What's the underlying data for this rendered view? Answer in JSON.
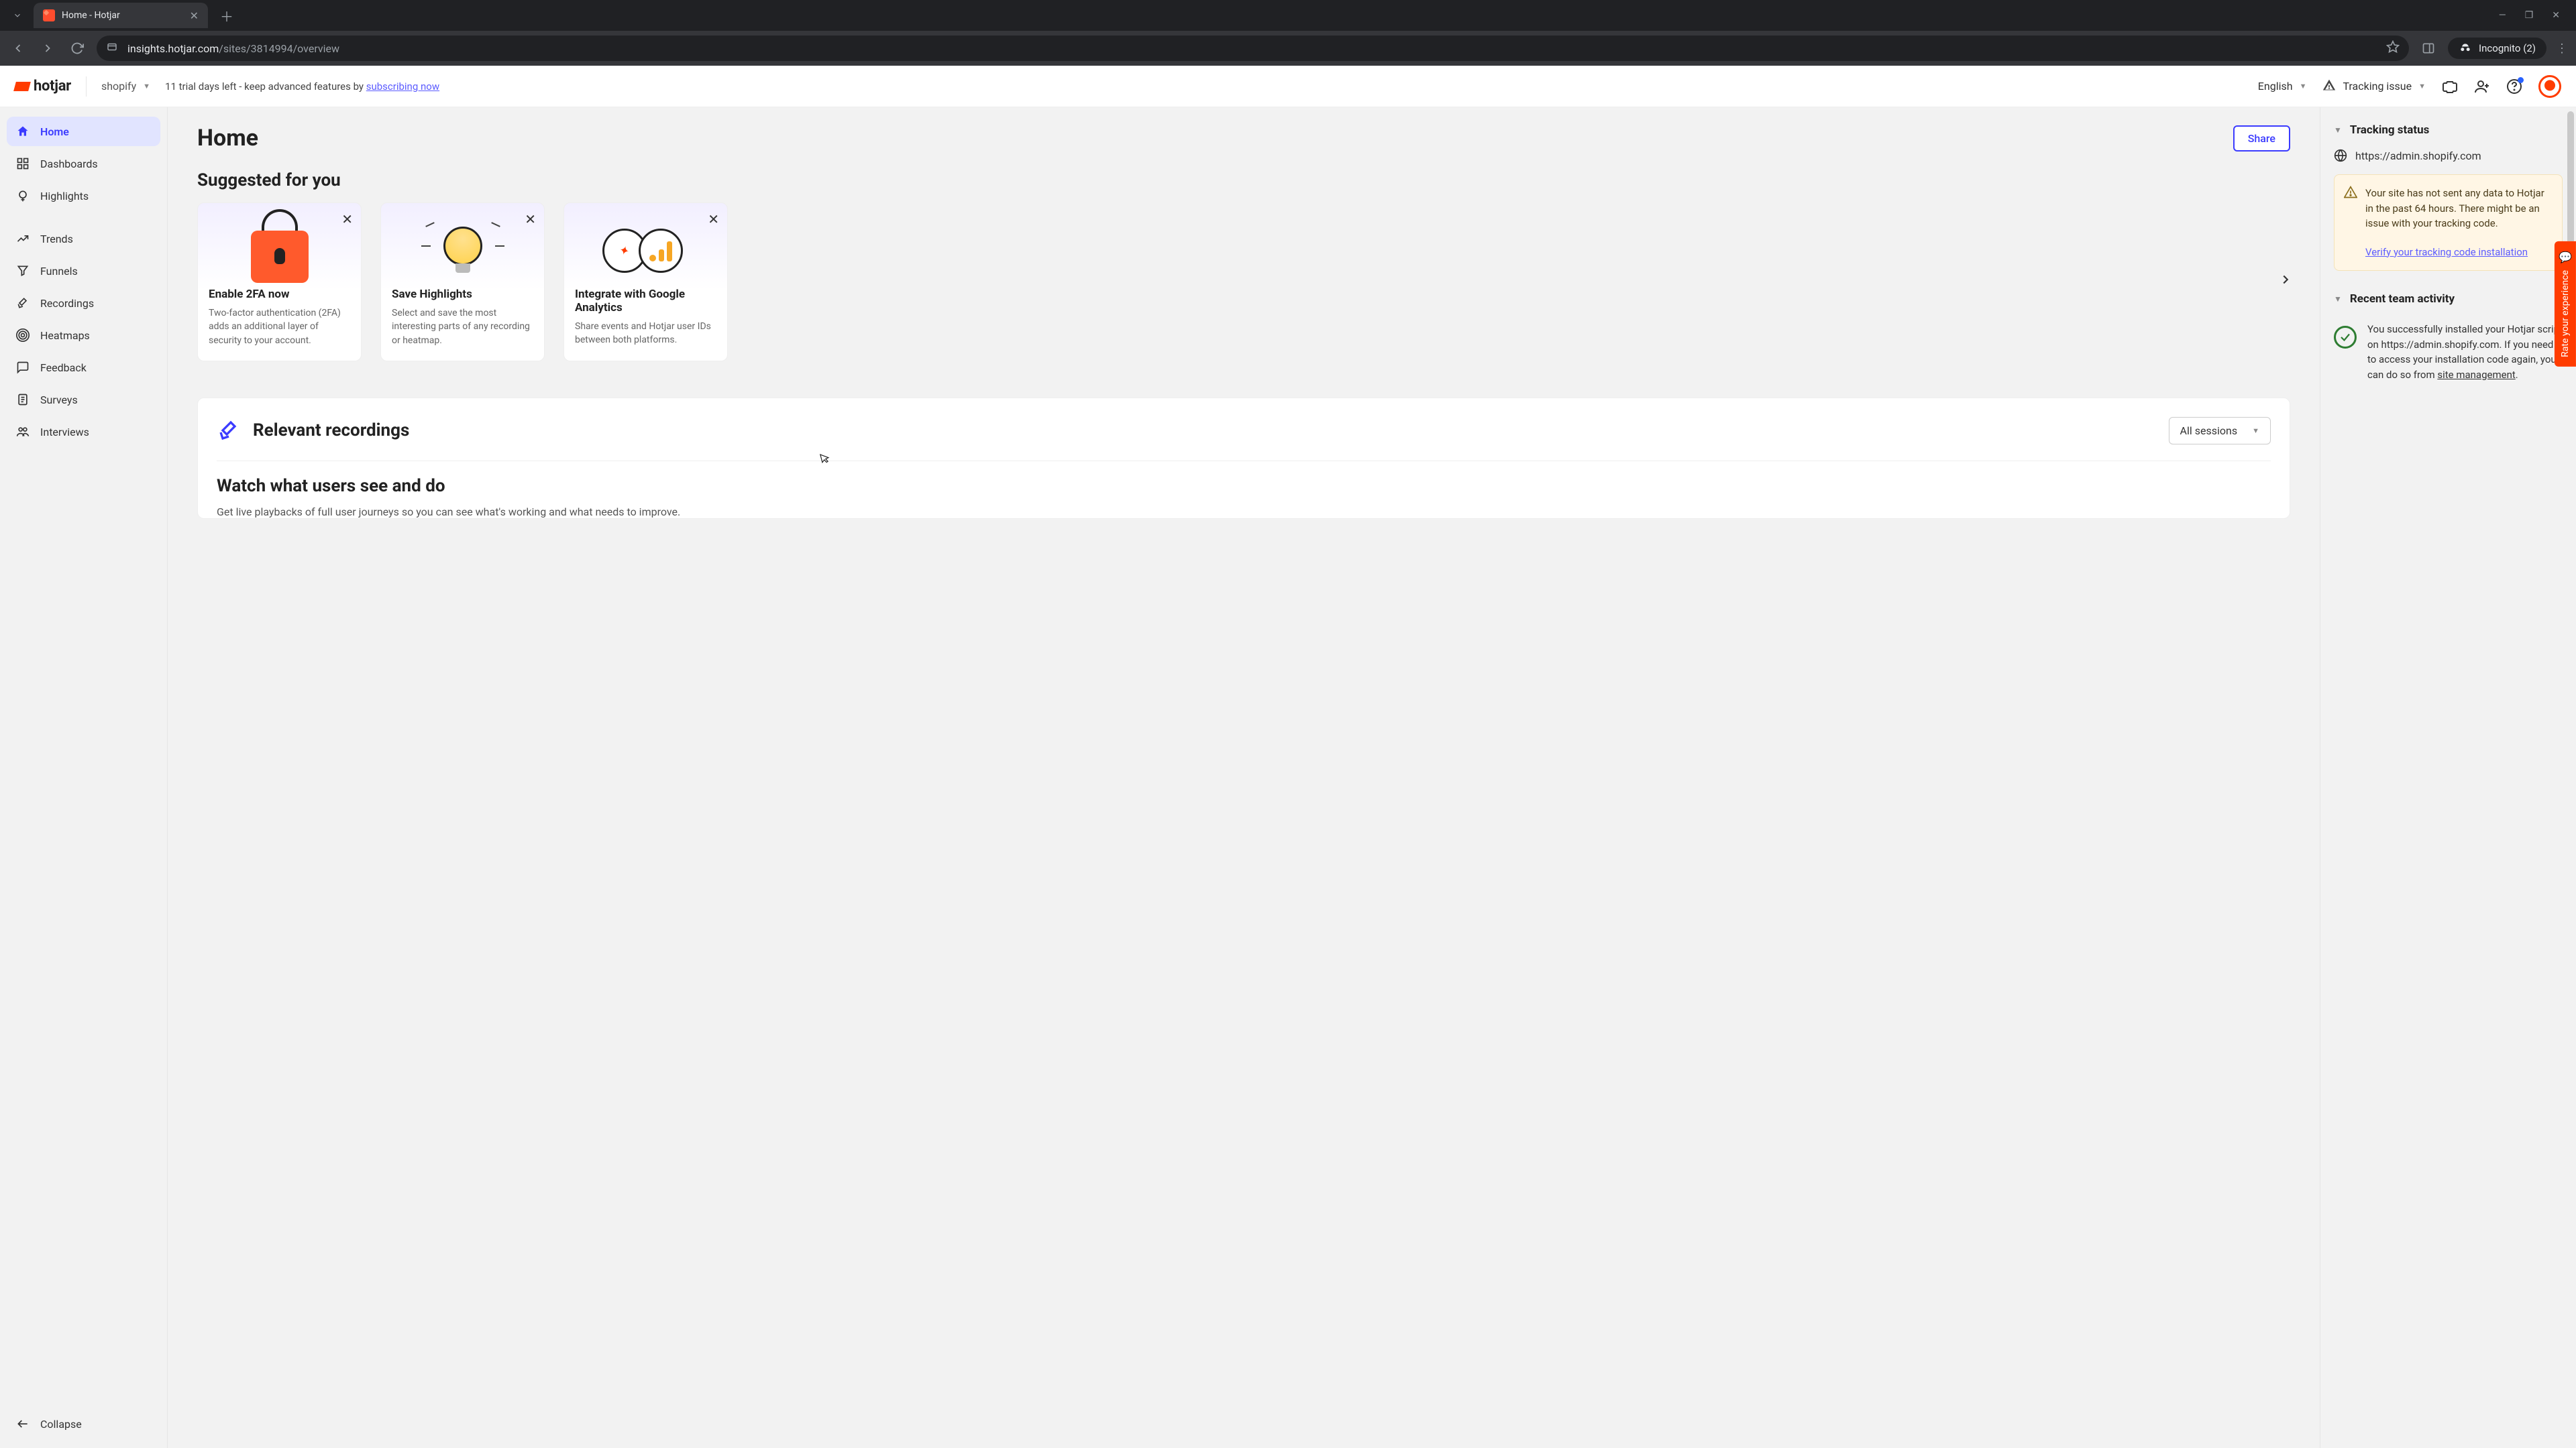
{
  "browser": {
    "tab_title": "Home - Hotjar",
    "url_host": "insights.hotjar.com",
    "url_path": "/sites/3814994/overview",
    "incognito_label": "Incognito (2)"
  },
  "header": {
    "logo_text": "hotjar",
    "site_selector": "shopify",
    "trial_prefix": "11 trial days left - keep advanced features by ",
    "trial_link": "subscribing now",
    "language": "English",
    "tracking_issue": "Tracking issue"
  },
  "sidebar": {
    "items": [
      {
        "label": "Home"
      },
      {
        "label": "Dashboards"
      },
      {
        "label": "Highlights"
      },
      {
        "label": "Trends"
      },
      {
        "label": "Funnels"
      },
      {
        "label": "Recordings"
      },
      {
        "label": "Heatmaps"
      },
      {
        "label": "Feedback"
      },
      {
        "label": "Surveys"
      },
      {
        "label": "Interviews"
      }
    ],
    "collapse": "Collapse"
  },
  "main": {
    "page_title": "Home",
    "share_label": "Share",
    "suggested_title": "Suggested for you",
    "cards": [
      {
        "title": "Enable 2FA now",
        "body": "Two-factor authentication (2FA) adds an additional layer of security to your account."
      },
      {
        "title": "Save Highlights",
        "body": "Select and save the most interesting parts of any recording or heatmap."
      },
      {
        "title": "Integrate with Google Analytics",
        "body": "Share events and Hotjar user IDs between both platforms."
      }
    ],
    "recordings": {
      "title": "Relevant recordings",
      "filter": "All sessions",
      "watch_title": "Watch what users see and do",
      "watch_body": "Get live playbacks of full user journeys so you can see what's working and what needs to improve."
    }
  },
  "right_rail": {
    "tracking_title": "Tracking status",
    "site_url": "https://admin.shopify.com",
    "alert_text": "Your site has not sent any data to Hotjar in the past 64 hours. There might be an issue with your tracking code.",
    "verify_link": "Verify your tracking code installation",
    "activity_title": "Recent team activity",
    "activity_text_1": "You successfully installed your Hotjar script on https://admin.shopify.com. If you need to access your installation code again, you can do so from ",
    "activity_link": "site management",
    "activity_text_2": "."
  },
  "feedback_tab": "Rate your experience"
}
